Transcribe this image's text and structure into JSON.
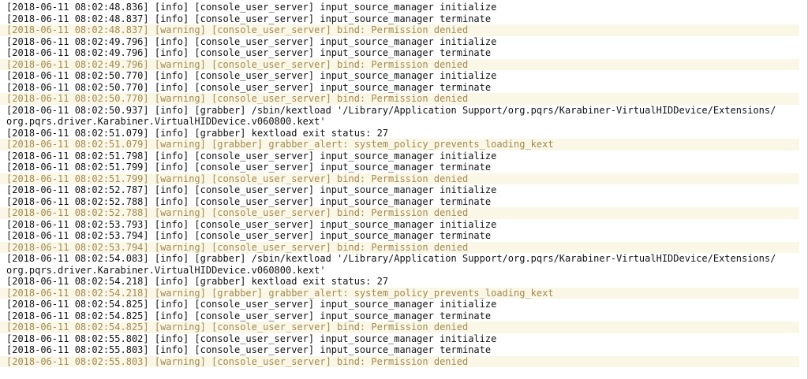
{
  "colors": {
    "background": "#ffffff",
    "info_text": "#111111",
    "warning_text": "#a08a52",
    "warning_background": "#fbf7e6"
  },
  "log": {
    "lines": [
      {
        "level": "info",
        "text": "[2018-06-11 08:02:48.836] [info] [console_user_server] input_source_manager initialize"
      },
      {
        "level": "info",
        "text": "[2018-06-11 08:02:48.837] [info] [console_user_server] input_source_manager terminate"
      },
      {
        "level": "warning",
        "text": "[2018-06-11 08:02:48.837] [warning] [console_user_server] bind: Permission denied"
      },
      {
        "level": "info",
        "text": "[2018-06-11 08:02:49.796] [info] [console_user_server] input_source_manager initialize"
      },
      {
        "level": "info",
        "text": "[2018-06-11 08:02:49.796] [info] [console_user_server] input_source_manager terminate"
      },
      {
        "level": "warning",
        "text": "[2018-06-11 08:02:49.796] [warning] [console_user_server] bind: Permission denied"
      },
      {
        "level": "info",
        "text": "[2018-06-11 08:02:50.770] [info] [console_user_server] input_source_manager initialize"
      },
      {
        "level": "info",
        "text": "[2018-06-11 08:02:50.770] [info] [console_user_server] input_source_manager terminate"
      },
      {
        "level": "warning",
        "text": "[2018-06-11 08:02:50.770] [warning] [console_user_server] bind: Permission denied"
      },
      {
        "level": "info",
        "text": "[2018-06-11 08:02:50.937] [info] [grabber] /sbin/kextload '/Library/Application Support/org.pqrs/Karabiner-VirtualHIDDevice/Extensions/\norg.pqrs.driver.Karabiner.VirtualHIDDevice.v060800.kext'"
      },
      {
        "level": "info",
        "text": "[2018-06-11 08:02:51.079] [info] [grabber] kextload exit status: 27"
      },
      {
        "level": "warning",
        "text": "[2018-06-11 08:02:51.079] [warning] [grabber] grabber_alert: system_policy_prevents_loading_kext"
      },
      {
        "level": "info",
        "text": "[2018-06-11 08:02:51.798] [info] [console_user_server] input_source_manager initialize"
      },
      {
        "level": "info",
        "text": "[2018-06-11 08:02:51.799] [info] [console_user_server] input_source_manager terminate"
      },
      {
        "level": "warning",
        "text": "[2018-06-11 08:02:51.799] [warning] [console_user_server] bind: Permission denied"
      },
      {
        "level": "info",
        "text": "[2018-06-11 08:02:52.787] [info] [console_user_server] input_source_manager initialize"
      },
      {
        "level": "info",
        "text": "[2018-06-11 08:02:52.788] [info] [console_user_server] input_source_manager terminate"
      },
      {
        "level": "warning",
        "text": "[2018-06-11 08:02:52.788] [warning] [console_user_server] bind: Permission denied"
      },
      {
        "level": "info",
        "text": "[2018-06-11 08:02:53.793] [info] [console_user_server] input_source_manager initialize"
      },
      {
        "level": "info",
        "text": "[2018-06-11 08:02:53.794] [info] [console_user_server] input_source_manager terminate"
      },
      {
        "level": "warning",
        "text": "[2018-06-11 08:02:53.794] [warning] [console_user_server] bind: Permission denied"
      },
      {
        "level": "info",
        "text": "[2018-06-11 08:02:54.083] [info] [grabber] /sbin/kextload '/Library/Application Support/org.pqrs/Karabiner-VirtualHIDDevice/Extensions/\norg.pqrs.driver.Karabiner.VirtualHIDDevice.v060800.kext'"
      },
      {
        "level": "info",
        "text": "[2018-06-11 08:02:54.218] [info] [grabber] kextload exit status: 27"
      },
      {
        "level": "warning",
        "text": "[2018-06-11 08:02:54.218] [warning] [grabber] grabber_alert: system_policy_prevents_loading_kext"
      },
      {
        "level": "info",
        "text": "[2018-06-11 08:02:54.825] [info] [console_user_server] input_source_manager initialize"
      },
      {
        "level": "info",
        "text": "[2018-06-11 08:02:54.825] [info] [console_user_server] input_source_manager terminate"
      },
      {
        "level": "warning",
        "text": "[2018-06-11 08:02:54.825] [warning] [console_user_server] bind: Permission denied"
      },
      {
        "level": "info",
        "text": "[2018-06-11 08:02:55.802] [info] [console_user_server] input_source_manager initialize"
      },
      {
        "level": "info",
        "text": "[2018-06-11 08:02:55.803] [info] [console_user_server] input_source_manager terminate"
      },
      {
        "level": "warning",
        "text": "[2018-06-11 08:02:55.803] [warning] [console_user_server] bind: Permission denied"
      }
    ]
  }
}
